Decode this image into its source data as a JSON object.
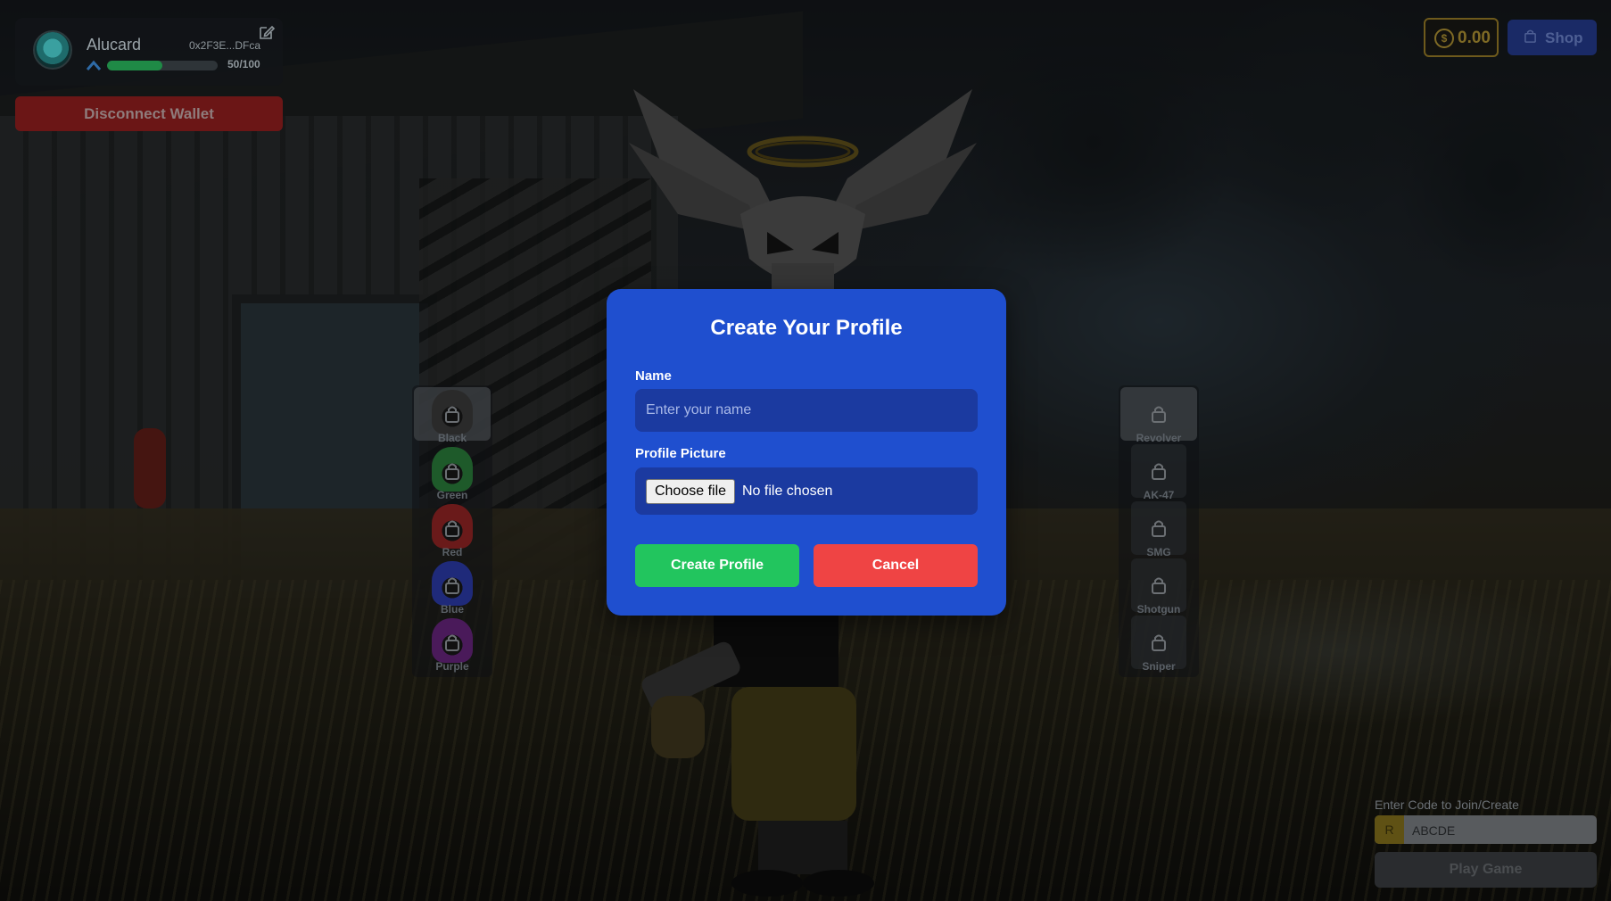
{
  "header": {
    "player_name": "Alucard",
    "wallet_address": "0x2F3E...DFca",
    "xp_text": "50/100",
    "xp_progress": 0.5,
    "disconnect_label": "Disconnect Wallet"
  },
  "topbar": {
    "coin_balance": "0.00",
    "coin_icon_glyph": "$",
    "shop_label": "Shop"
  },
  "skins": [
    {
      "label": "Black",
      "color": "#2a2a2a",
      "locked": true,
      "selected": true
    },
    {
      "label": "Green",
      "color": "#1e5a2a",
      "locked": true,
      "selected": false
    },
    {
      "label": "Red",
      "color": "#6a1a1a",
      "locked": true,
      "selected": false
    },
    {
      "label": "Blue",
      "color": "#1f2a7a",
      "locked": true,
      "selected": false
    },
    {
      "label": "Purple",
      "color": "#4a1a5a",
      "locked": true,
      "selected": false
    }
  ],
  "weapons": [
    {
      "label": "Revolver",
      "locked": true,
      "selected": true
    },
    {
      "label": "AK-47",
      "locked": true,
      "selected": false
    },
    {
      "label": "SMG",
      "locked": true,
      "selected": false
    },
    {
      "label": "Shotgun",
      "locked": true,
      "selected": false
    },
    {
      "label": "Sniper",
      "locked": true,
      "selected": false
    }
  ],
  "join": {
    "label": "Enter Code to Join/Create",
    "prefix": "R",
    "code_value": "ABCDE",
    "play_label": "Play Game"
  },
  "modal": {
    "title": "Create Your Profile",
    "name_label": "Name",
    "name_placeholder": "Enter your name",
    "name_value": "",
    "picture_label": "Profile Picture",
    "choose_file_label": "Choose file",
    "file_status": "No file chosen",
    "create_label": "Create Profile",
    "cancel_label": "Cancel"
  },
  "colors": {
    "modal_bg": "#1f4fcf",
    "input_bg": "#1b3aa0",
    "create": "#22c55e",
    "cancel": "#ef4444",
    "disconnect": "#b91c1c",
    "shop": "#1d4ed8",
    "coin_accent": "#eab308",
    "xp_fill": "#22c55e"
  }
}
